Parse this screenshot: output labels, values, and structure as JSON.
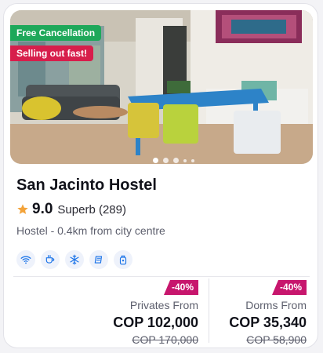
{
  "badges": {
    "free_cancellation": "Free Cancellation",
    "selling_out": "Selling out fast!"
  },
  "hostel": {
    "name": "San Jacinto Hostel",
    "rating_score": "9.0",
    "rating_text": "Superb (289)",
    "subtitle": "Hostel - 0.4km from city centre"
  },
  "gallery": {
    "total_dots": 5,
    "active_index": 0
  },
  "amenities": [
    {
      "icon": "wifi-icon"
    },
    {
      "icon": "coffee-cup-icon"
    },
    {
      "icon": "snowflake-icon"
    },
    {
      "icon": "linen-icon"
    },
    {
      "icon": "locker-icon"
    }
  ],
  "prices": {
    "privates": {
      "discount": "-40%",
      "label": "Privates From",
      "price": "COP 102,000",
      "original": "COP 170,000"
    },
    "dorms": {
      "discount": "-40%",
      "label": "Dorms From",
      "price": "COP 35,340",
      "original": "COP 58,900"
    }
  },
  "colors": {
    "accent_blue": "#1a73e8",
    "badge_green": "#1ea85a",
    "badge_red": "#d71e4b",
    "discount_pink": "#c7166d",
    "star_orange": "#f3a33a"
  }
}
